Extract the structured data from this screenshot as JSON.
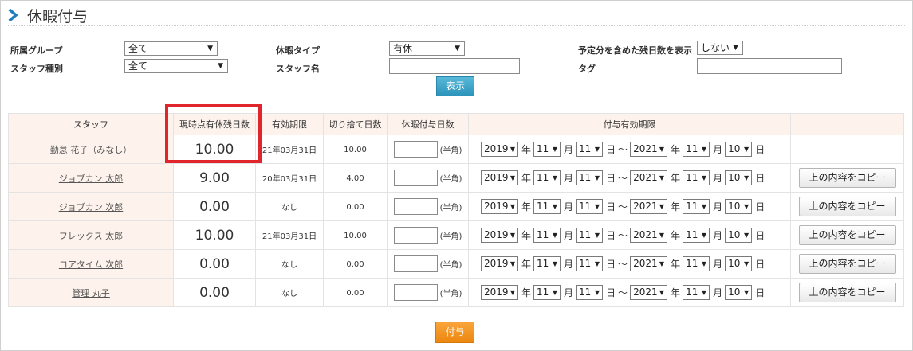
{
  "page": {
    "title": "休暇付与"
  },
  "filters": {
    "group_label": "所属グループ",
    "group_value": "全て",
    "staff_type_label": "スタッフ種別",
    "staff_type_value": "全て",
    "leave_type_label": "休暇タイプ",
    "leave_type_value": "有休",
    "staff_name_label": "スタッフ名",
    "staff_name_value": "",
    "remaining_label": "予定分を含めた残日数を表示",
    "remaining_value": "しない",
    "tag_label": "タグ",
    "tag_value": "",
    "show_button": "表示"
  },
  "table": {
    "headers": [
      "スタッフ",
      "現時点有休残日数",
      "有効期限",
      "切り捨て日数",
      "休暇付与日数",
      "付与有効期限",
      ""
    ],
    "hankaku": "(半角)",
    "unit_year": "年",
    "unit_month": "月",
    "unit_day": "日",
    "range_sep": "～",
    "copy_label": "上の内容をコピー",
    "rows": [
      {
        "staff": "勤怠 花子（みなし）",
        "remaining": "10.00",
        "expiry": "21年03月31日",
        "truncated": "10.00",
        "grant_days": "",
        "from_year": "2019",
        "from_month": "11",
        "from_day": "11",
        "to_year": "2021",
        "to_month": "11",
        "to_day": "10",
        "copy": false
      },
      {
        "staff": "ジョブカン 太郎",
        "remaining": "9.00",
        "expiry": "20年03月31日",
        "truncated": "4.00",
        "grant_days": "",
        "from_year": "2019",
        "from_month": "11",
        "from_day": "11",
        "to_year": "2021",
        "to_month": "11",
        "to_day": "10",
        "copy": true
      },
      {
        "staff": "ジョブカン 次郎",
        "remaining": "0.00",
        "expiry": "なし",
        "truncated": "0.00",
        "grant_days": "",
        "from_year": "2019",
        "from_month": "11",
        "from_day": "11",
        "to_year": "2021",
        "to_month": "11",
        "to_day": "10",
        "copy": true
      },
      {
        "staff": "フレックス 太郎",
        "remaining": "10.00",
        "expiry": "21年03月31日",
        "truncated": "10.00",
        "grant_days": "",
        "from_year": "2019",
        "from_month": "11",
        "from_day": "11",
        "to_year": "2021",
        "to_month": "11",
        "to_day": "10",
        "copy": true
      },
      {
        "staff": "コアタイム 次郎",
        "remaining": "0.00",
        "expiry": "なし",
        "truncated": "0.00",
        "grant_days": "",
        "from_year": "2019",
        "from_month": "11",
        "from_day": "11",
        "to_year": "2021",
        "to_month": "11",
        "to_day": "10",
        "copy": true
      },
      {
        "staff": "管理 丸子",
        "remaining": "0.00",
        "expiry": "なし",
        "truncated": "0.00",
        "grant_days": "",
        "from_year": "2019",
        "from_month": "11",
        "from_day": "11",
        "to_year": "2021",
        "to_month": "11",
        "to_day": "10",
        "copy": true
      }
    ]
  },
  "grant_button": "付与",
  "colors": {
    "accent_blue": "#1e7fc0",
    "highlight_red": "#e0262c",
    "grant_orange": "#f39a25",
    "show_blue": "#3ba3c9",
    "header_bg": "#fdf3ec"
  },
  "icons": {
    "title_icon": "chevron-right-icon",
    "select_arrow": "triangle-down-icon"
  }
}
